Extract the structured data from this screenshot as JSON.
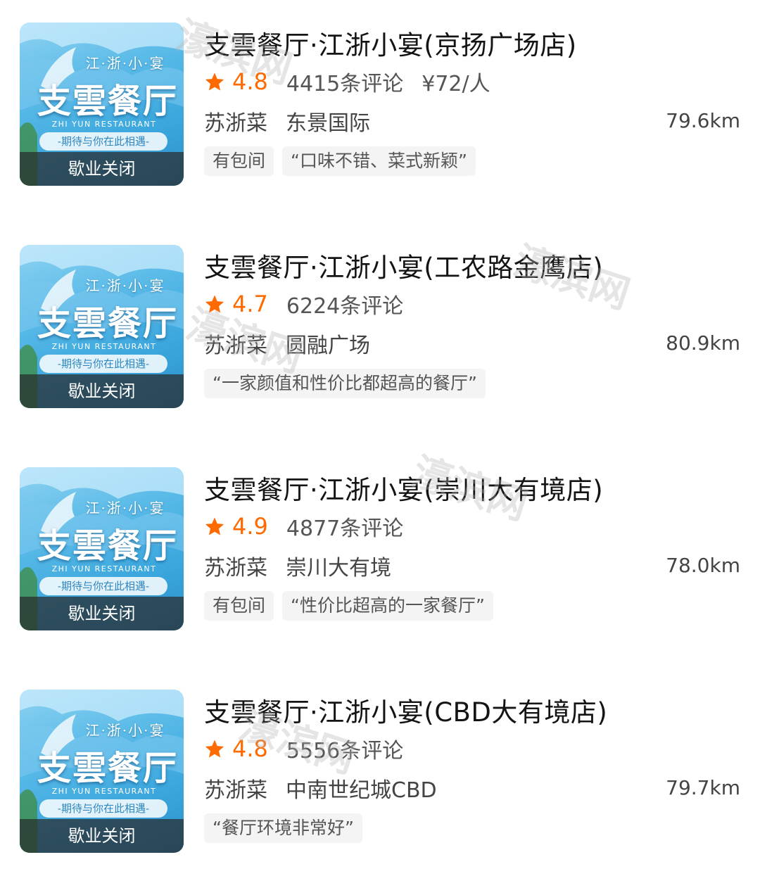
{
  "colors": {
    "accent": "#ff6a00",
    "thumb_blue": "#3aa6dd",
    "closed_overlay": "#333333"
  },
  "watermark_text": "濠滨网",
  "restaurants": [
    {
      "name": "支雲餐厅·江浙小宴(京扬广场店)",
      "rating": "4.8",
      "reviews": "4415条评论",
      "price": "¥72/人",
      "cuisine": "苏浙菜",
      "area": "东景国际",
      "distance": "79.6km",
      "tags": [
        "有包间",
        "“口味不错、菜式新颖”"
      ],
      "thumb": {
        "small": "江·浙·小·宴",
        "big": "支雲餐厅",
        "en": "ZHI YUN RESTAURANT",
        "slogan": "-期待与你在此相遇-",
        "status": "歇业关闭"
      }
    },
    {
      "name": "支雲餐厅·江浙小宴(工农路金鹰店)",
      "rating": "4.7",
      "reviews": "6224条评论",
      "price": "",
      "cuisine": "苏浙菜",
      "area": "圆融广场",
      "distance": "80.9km",
      "tags": [
        "“一家颜值和性价比都超高的餐厅”"
      ],
      "thumb": {
        "small": "江·浙·小·宴",
        "big": "支雲餐厅",
        "en": "ZHI YUN RESTAURANT",
        "slogan": "-期待与你在此相遇-",
        "status": "歇业关闭"
      }
    },
    {
      "name": "支雲餐厅·江浙小宴(崇川大有境店)",
      "rating": "4.9",
      "reviews": "4877条评论",
      "price": "",
      "cuisine": "苏浙菜",
      "area": "崇川大有境",
      "distance": "78.0km",
      "tags": [
        "有包间",
        "“性价比超高的一家餐厅”"
      ],
      "thumb": {
        "small": "江·浙·小·宴",
        "big": "支雲餐厅",
        "en": "ZHI YUN RESTAURANT",
        "slogan": "-期待与你在此相遇-",
        "status": "歇业关闭"
      }
    },
    {
      "name": "支雲餐厅·江浙小宴(CBD大有境店)",
      "rating": "4.8",
      "reviews": "5556条评论",
      "price": "",
      "cuisine": "苏浙菜",
      "area": "中南世纪城CBD",
      "distance": "79.7km",
      "tags": [
        "“餐厅环境非常好”"
      ],
      "thumb": {
        "small": "江·浙·小·宴",
        "big": "支雲餐厅",
        "en": "ZHI YUN RESTAURANT",
        "slogan": "-期待与你在此相遇-",
        "status": "歇业关闭"
      }
    }
  ]
}
